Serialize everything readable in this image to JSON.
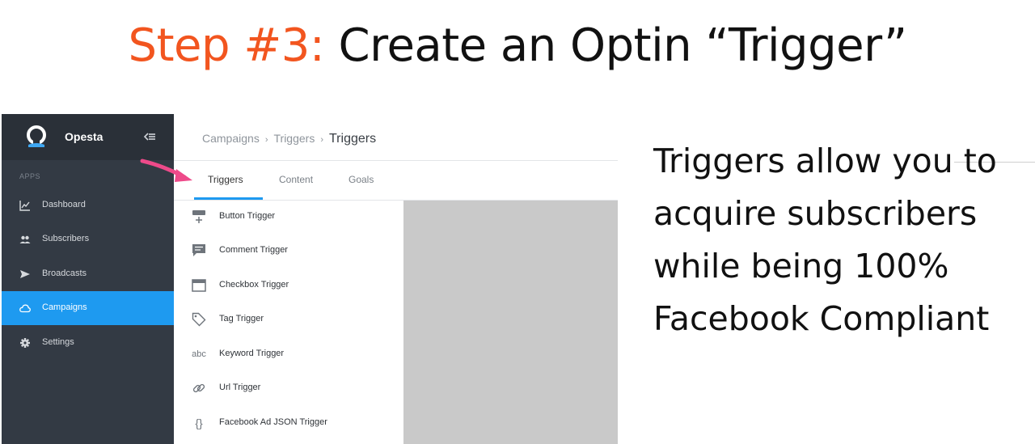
{
  "slide": {
    "title_step": "Step #3:",
    "title_rest": " Create an Optin “Trigger”",
    "side_text": "Triggers allow you to acquire subscribers while being 100% Facebook Compliant"
  },
  "sidebar": {
    "brand": "Opesta",
    "section_label": "APPS",
    "items": [
      {
        "label": "Dashboard",
        "icon": "chart-line-icon"
      },
      {
        "label": "Subscribers",
        "icon": "people-icon"
      },
      {
        "label": "Broadcasts",
        "icon": "send-icon"
      },
      {
        "label": "Campaigns",
        "icon": "cloud-icon",
        "active": true
      },
      {
        "label": "Settings",
        "icon": "gear-icon"
      }
    ]
  },
  "breadcrumb": {
    "items": [
      "Campaigns",
      "Triggers"
    ],
    "separator": "›",
    "current": "Triggers"
  },
  "tabs": [
    {
      "label": "Triggers",
      "active": true
    },
    {
      "label": "Content"
    },
    {
      "label": "Goals"
    }
  ],
  "triggers": [
    {
      "label": "Button Trigger",
      "icon": "button-icon"
    },
    {
      "label": "Comment Trigger",
      "icon": "comment-icon"
    },
    {
      "label": "Checkbox Trigger",
      "icon": "window-icon"
    },
    {
      "label": "Tag Trigger",
      "icon": "tag-icon"
    },
    {
      "label": "Keyword Trigger",
      "icon": "keyword-icon",
      "glyph": "abc"
    },
    {
      "label": "Url Trigger",
      "icon": "link-icon"
    },
    {
      "label": "Facebook Ad JSON Trigger",
      "icon": "braces-icon",
      "glyph": "{}"
    }
  ],
  "colors": {
    "accent": "#1e9af0",
    "title_accent": "#f2551f",
    "sidebar_bg": "#333a44",
    "pointer_arrow": "#ee4a8a"
  }
}
